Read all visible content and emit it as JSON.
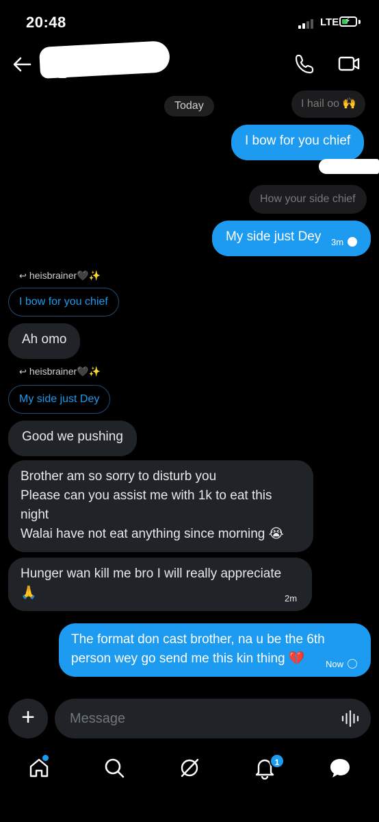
{
  "status_bar": {
    "time": "20:48",
    "network": "LTE"
  },
  "header": {
    "back_icon": "back-arrow-icon",
    "call_icon": "phone-icon",
    "video_icon": "video-camera-icon"
  },
  "conversation": {
    "day_label": "Today",
    "messages": [
      {
        "direction": "in",
        "text": "I hail oo 🙌"
      },
      {
        "direction": "out",
        "text": "I bow for you chief"
      },
      {
        "direction": "in",
        "text": "How your side chief"
      },
      {
        "direction": "out",
        "text": "My side just Dey",
        "time": "3m"
      },
      {
        "direction": "in",
        "reply_to_user": "heisbrainer🖤✨",
        "quoted": "I bow for you chief",
        "text": "Ah omo"
      },
      {
        "direction": "in",
        "reply_to_user": "heisbrainer🖤✨",
        "quoted": "My side just Dey",
        "text": "Good we pushing"
      },
      {
        "direction": "in",
        "text_lines": [
          "Brother am so sorry to disturb you",
          "Please can you assist me with 1k to eat this",
          "night",
          "Walai have not eat anything since morning 😭"
        ]
      },
      {
        "direction": "in",
        "text_lines": [
          "Hunger wan kill me bro I will really appreciate",
          "🙏"
        ],
        "time": "2m"
      },
      {
        "direction": "out",
        "text_lines": [
          "The format don cast brother, na u be the 6th",
          "person wey go send me this kin thing 💔"
        ],
        "time": "Now"
      }
    ]
  },
  "composer": {
    "placeholder": "Message",
    "plus_label": "+"
  },
  "tabbar": {
    "notifications_badge": "1",
    "colors": {
      "accent": "#1d9bf0"
    }
  }
}
